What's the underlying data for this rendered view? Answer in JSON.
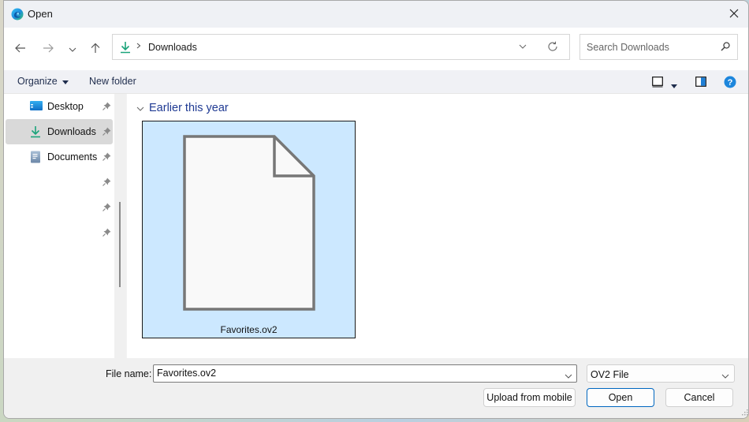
{
  "window": {
    "title": "Open",
    "close_label": "Close"
  },
  "navigation": {
    "back_icon": "arrow-left-icon",
    "forward_icon": "arrow-right-icon",
    "recent_icon": "chevron-down-icon",
    "up_icon": "arrow-up-icon",
    "address": {
      "location_icon": "download-icon",
      "breadcrumb": [
        "Downloads"
      ]
    },
    "refresh_icon": "refresh-icon",
    "search": {
      "placeholder": "Search Downloads",
      "value": ""
    }
  },
  "toolbar": {
    "organize_label": "Organize",
    "new_folder_label": "New folder",
    "view_icon": "view-layout-icon",
    "preview_pane_icon": "preview-pane-icon",
    "help_icon": "help-icon"
  },
  "sidebar": {
    "items": [
      {
        "label": "Desktop",
        "icon": "desktop-folder-icon",
        "pinned": true,
        "selected": false
      },
      {
        "label": "Downloads",
        "icon": "download-icon",
        "pinned": true,
        "selected": true
      },
      {
        "label": "Documents",
        "icon": "documents-icon",
        "pinned": true,
        "selected": false
      },
      {
        "label": "",
        "icon": "",
        "pinned": true,
        "selected": false
      },
      {
        "label": "",
        "icon": "",
        "pinned": true,
        "selected": false
      },
      {
        "label": "",
        "icon": "",
        "pinned": true,
        "selected": false
      }
    ]
  },
  "content": {
    "groups": [
      {
        "header": "Earlier this year",
        "files": [
          {
            "name": "Favorites.ov2",
            "icon": "generic-file-icon",
            "selected": true
          }
        ]
      }
    ]
  },
  "footer": {
    "file_name_label": "File name:",
    "file_name_value": "Favorites.ov2",
    "file_type_value": "OV2 File",
    "upload_label": "Upload from mobile",
    "open_label": "Open",
    "cancel_label": "Cancel"
  },
  "colors": {
    "accent": "#0067c0",
    "selection_fill": "#cce8ff",
    "download_green": "#1aa37a",
    "group_header": "#1f3a93"
  }
}
